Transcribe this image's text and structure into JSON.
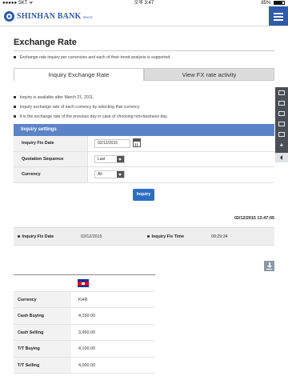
{
  "status_bar": {
    "carrier": "●●●●● SKT ᯤ",
    "time": "오후 3:47",
    "battery": "85%"
  },
  "header": {
    "bank_name": "SHINHAN BANK",
    "bank_sub": "SINCE"
  },
  "page": {
    "title": "Exchange Rate",
    "intro": "Exchange rate inquiry per currencies and each of their trend analysis is supported."
  },
  "tabs": [
    {
      "label": "Inquiry Exchange Rate",
      "active": true
    },
    {
      "label": "View FX rate activity",
      "active": false
    }
  ],
  "notes": [
    "Inquiry is available after March 21, 2011.",
    "Inquiry exchange rate of each currency by selecting that currency",
    "It is the exchange rate of the previous day in case of choosing non-business day."
  ],
  "settings": {
    "heading": "Inquiry settings",
    "fix_date_label": "Inquiry Fix Date",
    "fix_date_value": "02/12/2015",
    "sequence_label": "Quotation Sequence",
    "sequence_value": "Last",
    "currency_label": "Currency",
    "currency_value": "All",
    "button_label": "Inquiry"
  },
  "result": {
    "timestamp": "02/12/2015 13:47:05",
    "fix_date_label": "Inquiry Fix Date",
    "fix_date_value": "02/12/2015",
    "fix_time_label": "Inquiry Fix Time",
    "fix_time_value": "09:29:34"
  },
  "rates": {
    "flag_icon": "cambodia-flag-icon",
    "rows": [
      {
        "label": "Currency",
        "value": "KHR"
      },
      {
        "label": "Cash Buying",
        "value": "4,150.00"
      },
      {
        "label": "Cash Selling",
        "value": "3,950.00"
      },
      {
        "label": "T/T Buying",
        "value": "4,100.00"
      },
      {
        "label": "T/T Selling",
        "value": "4,000.00"
      }
    ]
  },
  "colors": {
    "brand": "#2e5aa8",
    "settings_header": "#5b84c8",
    "button": "#2e6dc4"
  }
}
